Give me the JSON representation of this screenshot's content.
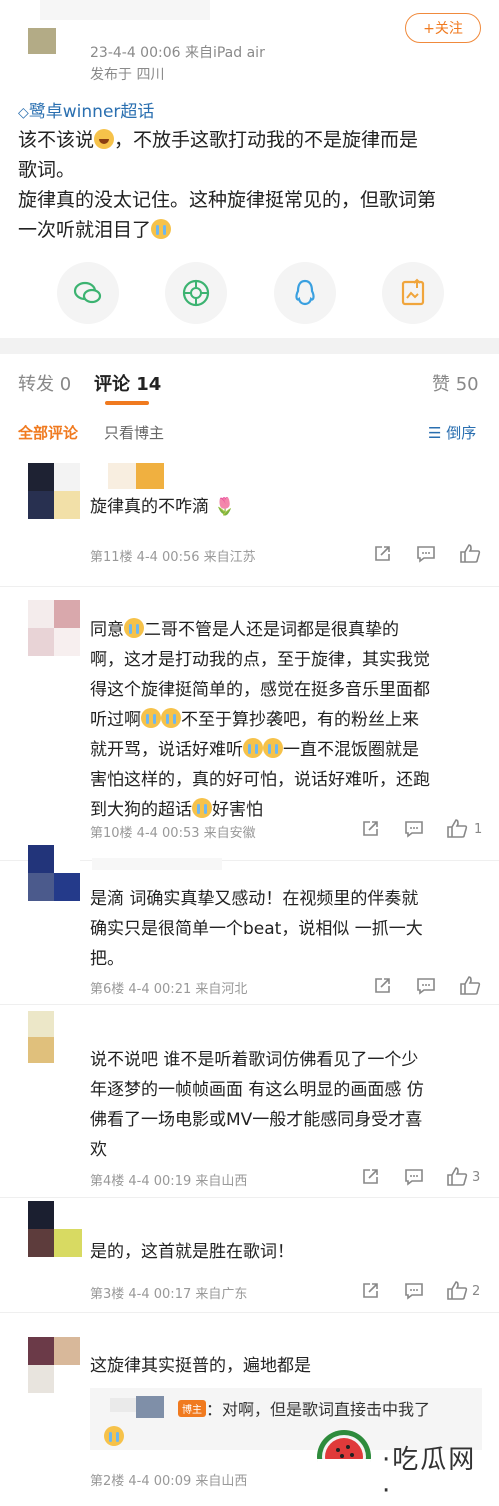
{
  "post": {
    "time_device": "23-4-4 00:06 来自iPad air",
    "published_from": "发布于 四川",
    "follow_label": "+关注",
    "supertopic": "鹭卓winner超话",
    "line1_a": "该不该说",
    "line1_b": "，不放手这歌打动我的不是旋律而是",
    "line2": "歌词。",
    "line3": "旋律真的没太记住。这种旋律挺常见的，但歌词第",
    "line4": "一次听就泪目了"
  },
  "share": [
    "wechat-icon",
    "moments-icon",
    "qq-icon",
    "save-image-icon"
  ],
  "tabs": {
    "repost": "转发 0",
    "comments": "评论 14",
    "likes": "赞 50"
  },
  "filters": {
    "all": "全部评论",
    "owner_only": "只看博主",
    "sort": "倒序"
  },
  "comments": [
    {
      "lines": [
        "旋律真的不咋滴"
      ],
      "floor": "第11楼 4-4 00:56 来自江苏",
      "likes": ""
    },
    {
      "lines": [
        "同意[cry]二哥不管是人还是词都是很真挚的",
        "啊，这才是打动我的点，至于旋律，其实我觉",
        "得这个旋律挺简单的，感觉在挺多音乐里面都",
        "听过啊[cry][cry]不至于算抄袭吧，有的粉丝上来",
        "就开骂，说话好难听[cry][cry]一直不混饭圈就是",
        "害怕这样的，真的好可怕，说话好难听，还跑",
        "到大狗的超话[cry]好害怕"
      ],
      "floor": "第10楼 4-4 00:53 来自安徽",
      "likes": "1"
    },
    {
      "lines": [
        "是滴 词确实真挚又感动！在视频里的伴奏就",
        "确实只是很简单一个beat，说相似 一抓一大",
        "把。"
      ],
      "floor": "第6楼 4-4 00:21 来自河北",
      "likes": ""
    },
    {
      "lines": [
        "说不说吧 谁不是听着歌词仿佛看见了一个少",
        "年逐梦的一帧帧画面 有这么明显的画面感 仿",
        "佛看了一场电影或MV一般才能感同身受才喜",
        "欢"
      ],
      "floor": "第4楼 4-4 00:19 来自山西",
      "likes": "3"
    },
    {
      "lines": [
        "是的，这首就是胜在歌词！"
      ],
      "floor": "第3楼 4-4 00:17 来自广东",
      "likes": "2"
    },
    {
      "lines": [
        "这旋律其实挺普的，遍地都是"
      ],
      "floor": "第2楼 4-4 00:09 来自山西",
      "likes": ""
    }
  ],
  "reply": {
    "badge": "博主",
    "text": "：对啊，但是歌词直接击中我了"
  },
  "watermark": {
    "text": "吃瓜网"
  },
  "colors": {
    "accent": "#f07a1f",
    "link": "#2a6fb0"
  }
}
